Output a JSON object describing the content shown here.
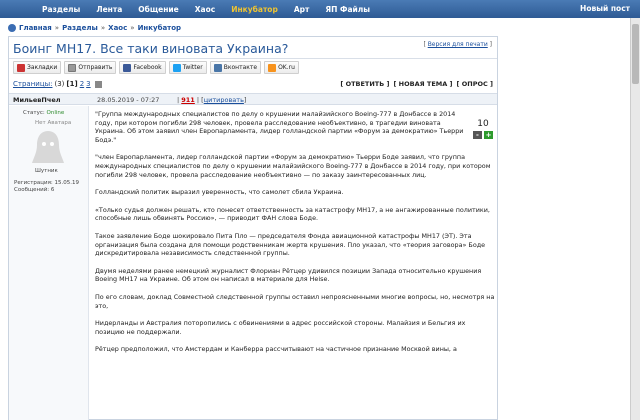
{
  "topnav": {
    "items": [
      {
        "label": "Разделы"
      },
      {
        "label": "Лента"
      },
      {
        "label": "Общение"
      },
      {
        "label": "Хаос"
      },
      {
        "label": "Инкубатор"
      },
      {
        "label": "Арт"
      },
      {
        "label": "ЯП Файлы"
      }
    ],
    "new_post": "Новый пост"
  },
  "breadcrumb": {
    "items": [
      "Главная",
      "Разделы",
      "Хаос",
      "Инкубатор"
    ],
    "sep": "»"
  },
  "topic": {
    "title": "Боинг МН17. Все таки виновата Украина?",
    "print_link": "Версия для печати"
  },
  "share": {
    "items": [
      {
        "label": "Закладки",
        "icon": "bookmark-icon",
        "color": "#c33"
      },
      {
        "label": "Отправить",
        "icon": "mail-icon",
        "color": "#888"
      },
      {
        "label": "Facebook",
        "icon": "facebook-icon",
        "color": "#3b5998"
      },
      {
        "label": "Twitter",
        "icon": "twitter-icon",
        "color": "#1da1f2"
      },
      {
        "label": "Вконтакте",
        "icon": "vk-icon",
        "color": "#4a76a8"
      },
      {
        "label": "OK.ru",
        "icon": "ok-icon",
        "color": "#f7931e"
      }
    ]
  },
  "pages": {
    "label": "Страницы:",
    "count": "(3)",
    "current": "[1]",
    "p2": "2",
    "p3": "3"
  },
  "actions": {
    "reply": "[ ОТВЕТИТЬ ]",
    "new_topic": "[ НОВАЯ ТЕМА ]",
    "poll": "[ ОПРОС ]"
  },
  "post": {
    "author": "МильевПчел",
    "date": "28.05.2019 - 07:27",
    "number": "911",
    "quote_link": "цитировать",
    "status_label": "Статус:",
    "status_value": "Online",
    "no_avatar": "Нет Аватара",
    "rank": "Шутник",
    "registered": "Регистрация: 15.05.19",
    "messages": "Сообщений: 6",
    "rating": "10",
    "vote_minus": "-",
    "vote_plus": "+",
    "paragraphs": [
      "\"Группа международных специалистов по делу о крушении малайзийского Boeing-777 в Донбассе в 2014 году, при котором погибли 298 человек, провела расследование необъективно, в трагедии виновата Украина. Об этом заявил член Европарламента, лидер голландской партии «Форум за демократию» Тьерри Бодэ.\"",
      "\"член Европарламента, лидер голландской партии «Форум за демократию» Тьерри Боде заявил, что группа международных специалистов по делу о крушении малайзийского Boeing-777 в Донбассе в 2014 году, при котором погибли 298 человек, провела расследование необъективно — по заказу заинтересованных лиц.",
      "Голландский политик выразил уверенность, что самолет сбила Украина.",
      "«Только судья должен решать, кто понесет ответственность за катастрофу MH17, а не ангажированные политики, способные лишь обвинять Россию», — приводит ФАН слова Боде.",
      "Такое заявление Боде шокировало Пита Пло — председателя Фонда авиационной катастрофы MH17 (ЭТ). Эта организация была создана для помощи родственникам жертв крушения. Пло указал, что «теория заговора» Боде дискредитировала независимость следственной группы.",
      "Двумя неделями ранее немецкий журналист Флориан Рётцер удивился позиции Запада относительно крушения Boeing MH17 на Украине. Об этом он написал в материале для Heise.",
      "По его словам, доклад Совместной следственной группы оставил непроясненными многие вопросы, но, несмотря на это,",
      "Нидерланды и Австралия поторопились с обвинениями в адрес российской стороны. Малайзия и Бельгия их позицию не поддержали.",
      "Рётцер предположил, что Амстердам и Канберра рассчитывают на частичное признание Москвой вины, а"
    ]
  }
}
